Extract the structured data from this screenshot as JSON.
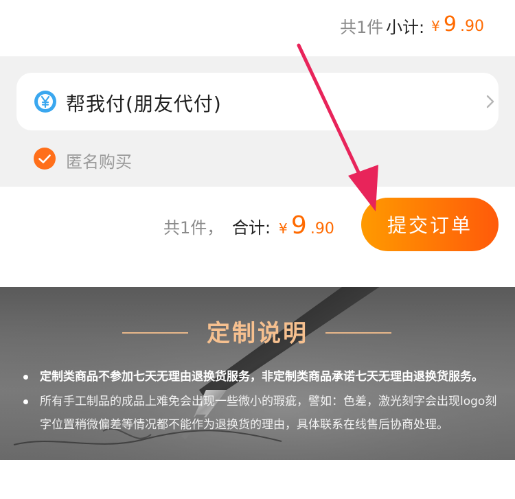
{
  "subtotal": {
    "count_text": "共1件",
    "label": "小计:",
    "currency": "¥",
    "price_int": "9",
    "price_dec": ".90"
  },
  "pay_option": {
    "label": "帮我付(朋友代付)",
    "icon": "yen-coin-icon",
    "icon_color": "#3aa7ef"
  },
  "anonymous": {
    "label": "匿名购买",
    "checked": true,
    "check_color": "#ff6f1a"
  },
  "total": {
    "count_text": "共1件，",
    "label": "合计:",
    "currency": "¥",
    "price_int": "9",
    "price_dec": ".90"
  },
  "submit_button": {
    "label": "提交订单"
  },
  "custom_notice": {
    "title": "定制说明",
    "rules": [
      "定制类商品不参加七天无理由退换货服务，非定制类商品承诺七天无理由退换货服务。",
      "所有手工制品的成品上难免会出现一些微小的瑕疵，譬如：色差，激光刻字会出现logo刻字位置稍微偏差等情况都不能作为退换货的理由，具体联系在线售后协商处理。"
    ]
  },
  "colors": {
    "accent": "#ff6a00",
    "button_gradient_start": "#ff9a00",
    "button_gradient_end": "#ff5a0a",
    "arrow": "#e8245a",
    "banner_title": "#f6c08f",
    "background_gray": "#f1f1f1"
  }
}
